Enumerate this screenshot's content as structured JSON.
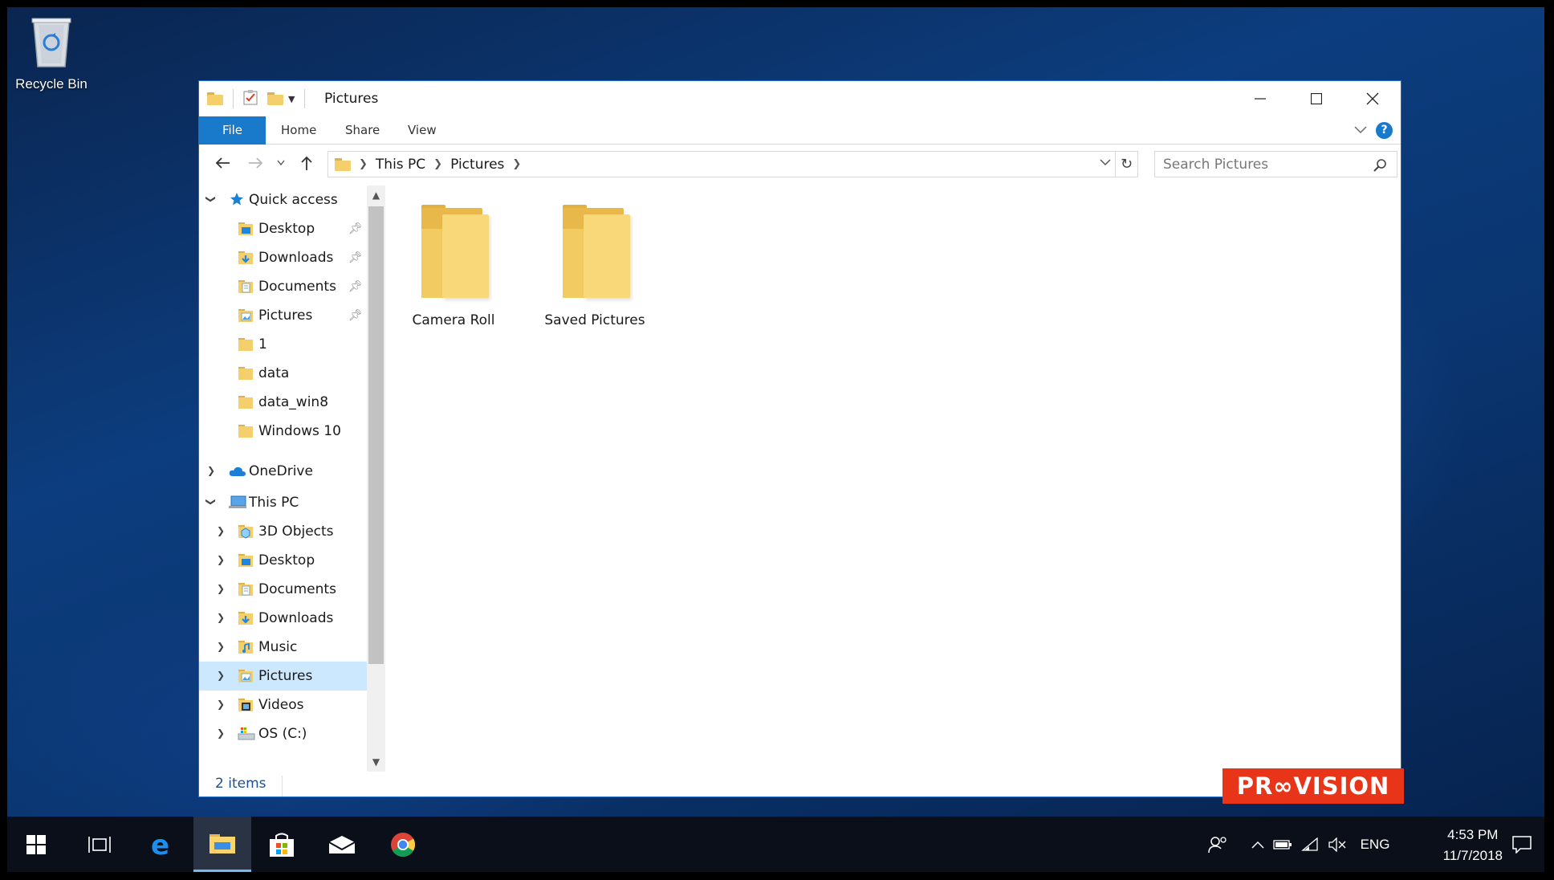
{
  "desktop": {
    "recycle_bin_label": "Recycle Bin"
  },
  "window": {
    "title": "Pictures",
    "minimize_icon": "minimize-icon",
    "maximize_icon": "maximize-icon",
    "close_icon": "close-icon"
  },
  "ribbon": {
    "tabs": [
      "File",
      "Home",
      "Share",
      "View"
    ],
    "active_tab_color": "#1979ca",
    "help_label": "?"
  },
  "address_bar": {
    "crumbs": [
      "This PC",
      "Pictures"
    ]
  },
  "search": {
    "placeholder": "Search Pictures"
  },
  "nav_pane": {
    "quick_access": {
      "label": "Quick access",
      "items": [
        {
          "label": "Desktop",
          "pinned": true,
          "icon": "desktop-folder-icon"
        },
        {
          "label": "Downloads",
          "pinned": true,
          "icon": "downloads-folder-icon"
        },
        {
          "label": "Documents",
          "pinned": true,
          "icon": "documents-folder-icon"
        },
        {
          "label": "Pictures",
          "pinned": true,
          "icon": "pictures-folder-icon"
        },
        {
          "label": "1",
          "pinned": false,
          "icon": "folder-icon"
        },
        {
          "label": "data",
          "pinned": false,
          "icon": "folder-icon"
        },
        {
          "label": "data_win8",
          "pinned": false,
          "icon": "folder-icon"
        },
        {
          "label": "Windows 10",
          "pinned": false,
          "icon": "folder-icon"
        }
      ]
    },
    "onedrive_label": "OneDrive",
    "this_pc": {
      "label": "This PC",
      "items": [
        {
          "label": "3D Objects",
          "icon": "3d-objects-folder-icon"
        },
        {
          "label": "Desktop",
          "icon": "desktop-folder-icon"
        },
        {
          "label": "Documents",
          "icon": "documents-folder-icon"
        },
        {
          "label": "Downloads",
          "icon": "downloads-folder-icon"
        },
        {
          "label": "Music",
          "icon": "music-folder-icon"
        },
        {
          "label": "Pictures",
          "icon": "pictures-folder-icon",
          "selected": true
        },
        {
          "label": "Videos",
          "icon": "videos-folder-icon"
        },
        {
          "label": "OS (C:)",
          "icon": "drive-icon"
        }
      ]
    }
  },
  "content": {
    "items": [
      {
        "label": "Camera Roll",
        "icon": "folder-icon"
      },
      {
        "label": "Saved Pictures",
        "icon": "folder-icon"
      }
    ]
  },
  "status_bar": {
    "item_count": "2 items"
  },
  "watermark": {
    "text": "PR∞VISION",
    "color": "#e8351a"
  },
  "taskbar": {
    "language": "ENG",
    "time": "4:53 PM",
    "date": "11/7/2018",
    "pinned": [
      "start-icon",
      "task-view-icon",
      "edge-icon",
      "file-explorer-icon",
      "store-icon",
      "mail-icon",
      "chrome-icon"
    ],
    "active_app": "file-explorer-icon"
  }
}
